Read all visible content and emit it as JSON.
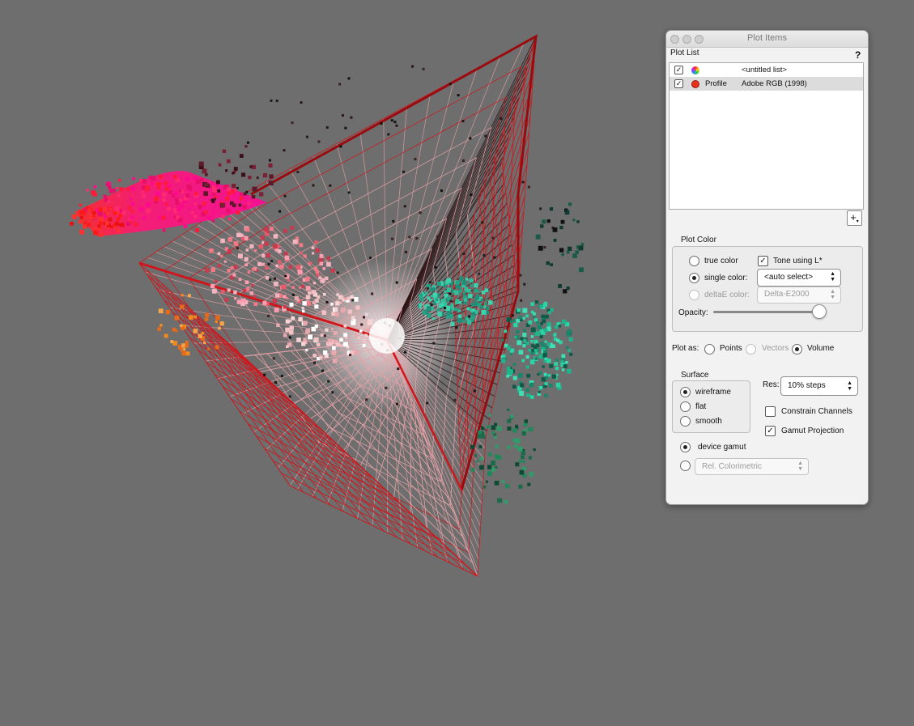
{
  "window": {
    "title": "Plot Items",
    "help_label": "?"
  },
  "plot_list": {
    "label": "Plot List",
    "rows": [
      {
        "checked": true,
        "icon": "color-wheel-icon",
        "type": "",
        "name": "<untitled list>",
        "selected": false
      },
      {
        "checked": true,
        "icon": "red-dot-icon",
        "type": "Profile",
        "name": "Adobe RGB (1998)",
        "selected": true
      }
    ],
    "add_button_label": "+"
  },
  "plot_color": {
    "label": "Plot Color",
    "true_color_label": "true color",
    "single_color_label": "single color:",
    "deltae_color_label": "deltaE color:",
    "selected": "single color",
    "tone_using_l_label": "Tone using L*",
    "tone_using_l_checked": true,
    "single_color_select": "<auto select>",
    "deltae_select": "Delta-E2000",
    "opacity_label": "Opacity:",
    "opacity_value": 0.95
  },
  "plot_as": {
    "label": "Plot as:",
    "options": [
      "Points",
      "Vectors",
      "Volume"
    ],
    "selected": "Volume"
  },
  "surface": {
    "label": "Surface",
    "options": [
      "wireframe",
      "flat",
      "smooth"
    ],
    "selected": "wireframe"
  },
  "resolution": {
    "label": "Res:",
    "value": "10% steps"
  },
  "constrain_channels": {
    "label": "Constrain Channels",
    "checked": false
  },
  "gamut_projection": {
    "label": "Gamut Projection",
    "checked": true
  },
  "gamut_mode": {
    "device_gamut_label": "device gamut",
    "selected": "device gamut",
    "intent_select": "Rel. Colorimetric"
  },
  "colors": {
    "background": "#6e6e6e",
    "wireframe_outer": "#d0151b",
    "wireframe_inner": "#e7a3a8",
    "edge_dark": "#9a0b0f",
    "magenta": "#ff0a8c",
    "red": "#ff1a1a",
    "teal": "#2fbf9b",
    "orange": "#f08a1e"
  }
}
